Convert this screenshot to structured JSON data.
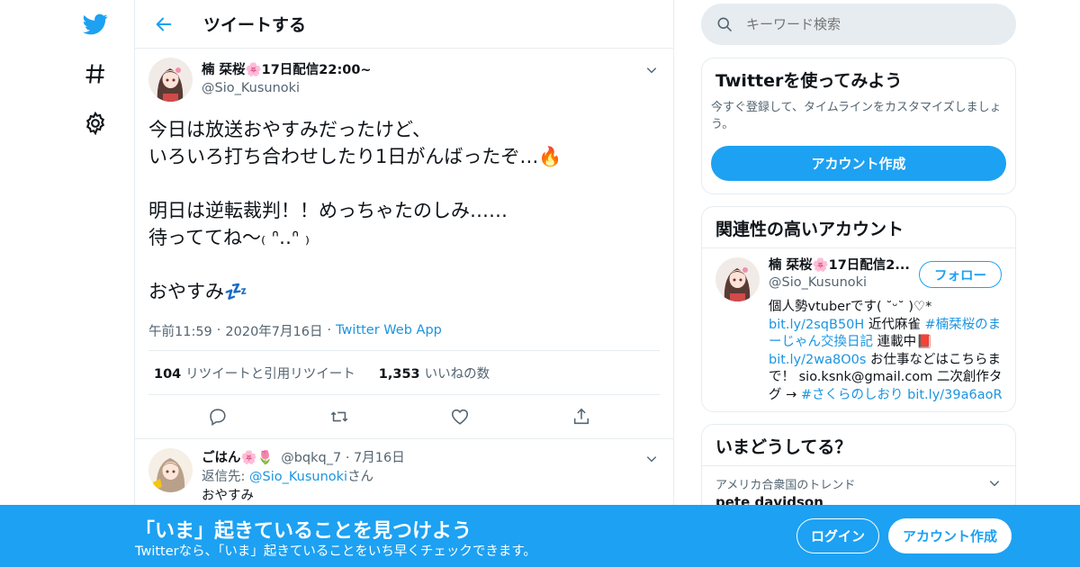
{
  "colors": {
    "accent": "#1da1f2",
    "text": "#0f1419",
    "muted": "#536471",
    "border": "#e6ecf0",
    "link": "#1b95e0"
  },
  "nav": {
    "icons": [
      "twitter-bird-icon",
      "hashtag-icon",
      "gear-icon"
    ]
  },
  "header": {
    "title": "ツイートする"
  },
  "tweet": {
    "name": "楠 栞桜🌸17日配信22:00~",
    "handle": "@Sio_Kusunoki",
    "body": "今日は放送おやすみだったけど、\nいろいろ打ち合わせしたり1日がんばったぞ…🔥\n\n明日は逆転裁判！！めっちゃたのしみ……\n待っててね～₍ ᐢ‥ᐢ ₎\n\nおやすみ💤",
    "time": "午前11:59",
    "date": "2020年7月16日",
    "client": "Twitter Web App",
    "retweets": "104",
    "retweets_label": "リツイートと引用リツイート",
    "likes": "1,353",
    "likes_label": "いいねの数"
  },
  "reply": {
    "name": "ごはん🌸🌷",
    "handle": "@bqkq_7",
    "date": "7月16日",
    "replying_prefix": "返信先: ",
    "replying_to": "@Sio_Kusunoki",
    "replying_suffix": "さん",
    "text": "おやすみ"
  },
  "search": {
    "placeholder": "キーワード検索"
  },
  "signup_card": {
    "title": "Twitterを使ってみよう",
    "subtitle": "今すぐ登録して、タイムラインをカスタマイズしましょう。",
    "button": "アカウント作成"
  },
  "related": {
    "title": "関連性の高いアカウント",
    "name": "楠 栞桜🌸17日配信2...",
    "handle": "@Sio_Kusunoki",
    "follow": "フォロー",
    "bio_1": "個人勢vtuberです( ˘ᵕ˘ )♡* ",
    "link_1": "bit.ly/2sqB50H",
    "bio_2": " 近代麻雀 ",
    "hashtag_1": "#楠栞桜のまーじゃん交換日記",
    "bio_3": " 連載中📕 ",
    "link_2": "bit.ly/2wa8O0s",
    "bio_4": " お仕事などはこちらまで！ sio.ksnk@gmail.com 二次創作タグ → ",
    "hashtag_2": "#さくらのしおり",
    "link_3": "bit.ly/39a6aoR"
  },
  "trends": {
    "title": "いまどうしてる？",
    "location": "アメリカ合衆国のトレンド",
    "first": "pete davidson"
  },
  "banner": {
    "title": "「いま」起きていることを見つけよう",
    "subtitle": "Twitterなら、「いま」起きていることをいち早くチェックできます。",
    "login": "ログイン",
    "signup": "アカウント作成"
  }
}
